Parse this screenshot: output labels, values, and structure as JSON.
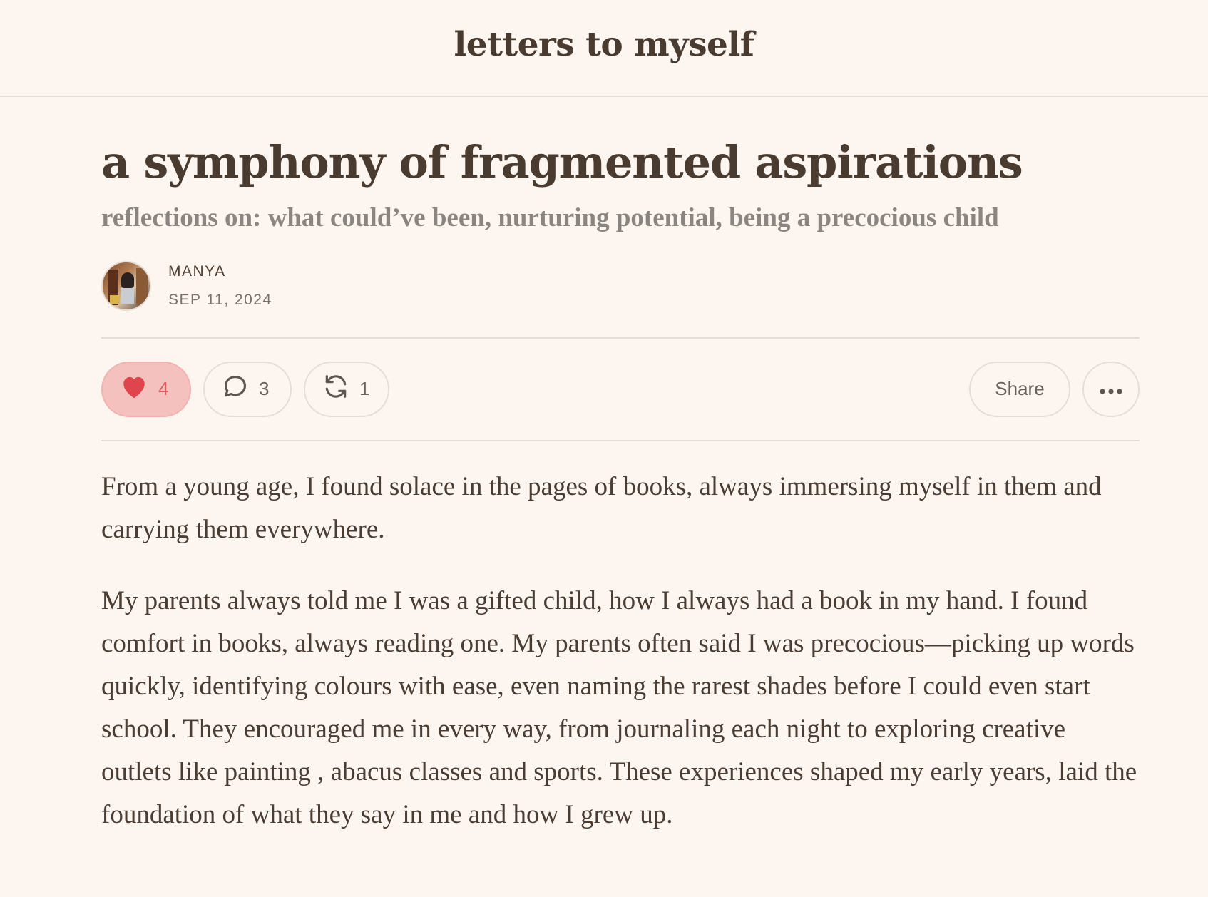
{
  "publication": {
    "title": "letters to myself"
  },
  "post": {
    "title": "a symphony of fragmented aspirations",
    "subtitle": "reflections on: what could’ve been, nurturing potential, being a precocious child",
    "author": "MANYA",
    "date": "SEP 11, 2024"
  },
  "actions": {
    "likes": "4",
    "comments": "3",
    "restacks": "1",
    "share_label": "Share",
    "like_color": "#e25b5e"
  },
  "body": {
    "paragraphs": [
      "From a young age, I found solace in the pages of books, always immersing myself in them and carrying them everywhere.",
      "My parents always told me I was a gifted child, how I always had a book in my hand. I found comfort in books, always reading one. My parents often said I was precocious—picking up words quickly, identifying colours with ease, even naming the rarest shades before I could even start school. They encouraged me in every way, from journaling each night to exploring creative outlets like painting , abacus classes and sports. These experiences shaped my early years, laid the foundation of what they say in me and how I grew up."
    ]
  }
}
